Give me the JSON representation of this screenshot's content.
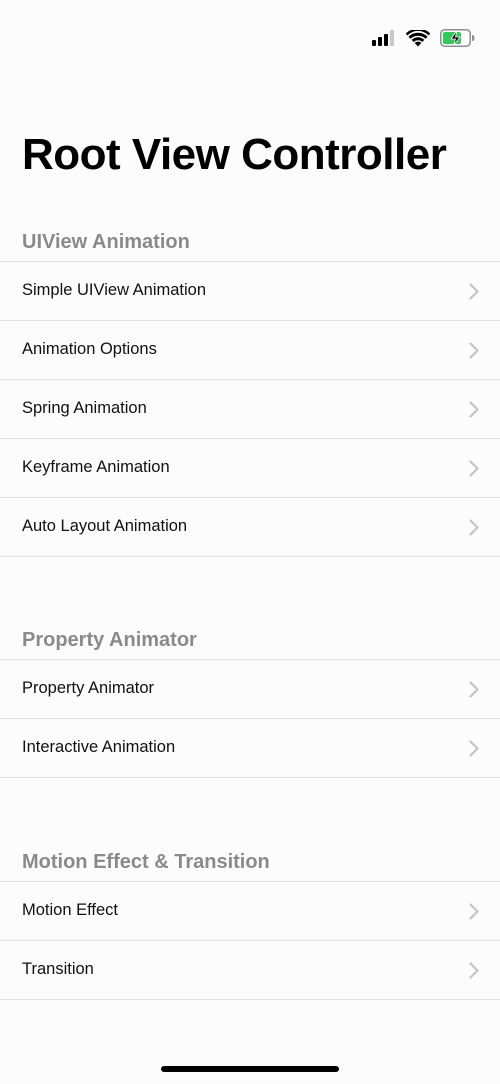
{
  "title": "Root View Controller",
  "sections": [
    {
      "header": "UIView Animation",
      "items": [
        {
          "label": "Simple UIView Animation"
        },
        {
          "label": "Animation Options"
        },
        {
          "label": "Spring Animation"
        },
        {
          "label": "Keyframe Animation"
        },
        {
          "label": "Auto Layout Animation"
        }
      ]
    },
    {
      "header": "Property Animator",
      "items": [
        {
          "label": "Property Animator"
        },
        {
          "label": "Interactive Animation"
        }
      ]
    },
    {
      "header": "Motion Effect & Transition",
      "items": [
        {
          "label": "Motion Effect"
        },
        {
          "label": "Transition"
        }
      ]
    }
  ],
  "colors": {
    "background": "#fdfcfd",
    "section_header": "#8a8a8e",
    "separator": "#e2e2e4",
    "chevron": "#c4c4c7",
    "battery_fill": "#34c759"
  },
  "icons": {
    "signal": "cellular-signal-icon",
    "wifi": "wifi-icon",
    "battery": "battery-charging-icon",
    "disclosure": "chevron-right-icon"
  }
}
